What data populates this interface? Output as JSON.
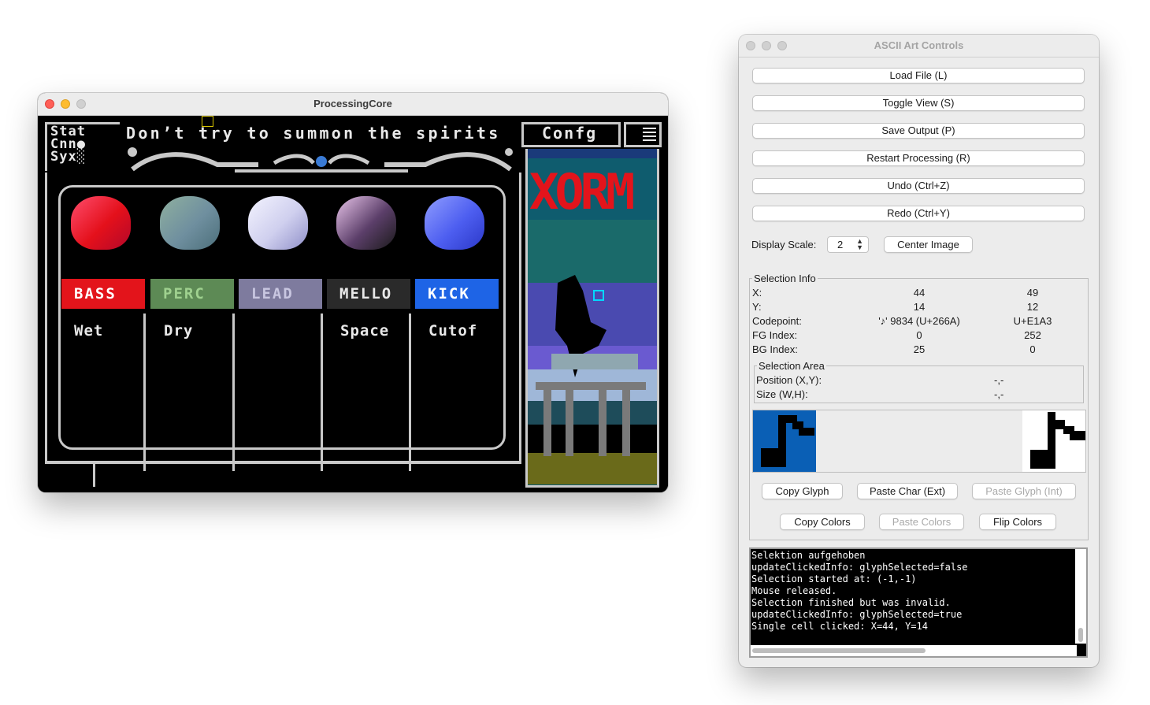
{
  "processing_window": {
    "title": "ProcessingCore",
    "status_lines": [
      "Stat",
      "Cnn●",
      "Syx░"
    ],
    "banner": "Don’t try to summon the spirits",
    "config_label": "Confg",
    "menu_icon": "hamburger-icon",
    "art_title": "XORM",
    "pads": [
      {
        "label": "BASS",
        "color": "#e3141b",
        "label_bg": "#e3141b",
        "label_fg": "#ffffff",
        "blob": [
          "#ff4d6d",
          "#e4101b",
          "#b2082a"
        ]
      },
      {
        "label": "PERC",
        "color": "#6e8f6a",
        "label_bg": "#5d8a55",
        "label_fg": "#9fd18f",
        "blob": [
          "#8fb09f",
          "#6f8f9f",
          "#4c6f7a"
        ]
      },
      {
        "label": "LEAD",
        "color": "#a9a6c6",
        "label_bg": "#7e7b9e",
        "label_fg": "#c8c6e0",
        "blob": [
          "#f4f4ff",
          "#cfcfee",
          "#8f8fc9"
        ]
      },
      {
        "label": "MELLO",
        "color": "#333",
        "label_bg": "#2a2a2a",
        "label_fg": "#e8e8e8",
        "blob": [
          "#e9c5ea",
          "#5c3f6a",
          "#1a1a1a"
        ]
      },
      {
        "label": "KICK",
        "color": "#1e64e6",
        "label_bg": "#1e64e6",
        "label_fg": "#ffffff",
        "blob": [
          "#8f9dff",
          "#4d5ef0",
          "#2b38c8"
        ]
      }
    ],
    "columns": [
      "Wet",
      "Dry",
      "",
      "Space",
      "Cutof"
    ]
  },
  "controls_window": {
    "title": "ASCII Art Controls",
    "buttons": [
      "Load File (L)",
      "Toggle View (S)",
      "Save Output (P)",
      "Restart Processing (R)",
      "Undo (Ctrl+Z)",
      "Redo (Ctrl+Y)"
    ],
    "display_scale_label": "Display Scale:",
    "display_scale_value": "2",
    "center_image_label": "Center Image",
    "selection_info": {
      "title": "Selection Info",
      "rows": [
        {
          "label": "X:",
          "a": "44",
          "b": "49"
        },
        {
          "label": "Y:",
          "a": "14",
          "b": "12"
        },
        {
          "label": "Codepoint:",
          "a": "'♪' 9834 (U+266A)",
          "b": "U+E1A3"
        },
        {
          "label": "FG Index:",
          "a": "0",
          "b": "252"
        },
        {
          "label": "BG Index:",
          "a": "25",
          "b": "0"
        }
      ],
      "area": {
        "title": "Selection Area",
        "position_label": "Position (X,Y):",
        "position_value": "-,-",
        "size_label": "Size (W,H):",
        "size_value": "-,-"
      }
    },
    "glyph_buttons": [
      {
        "label": "Copy Glyph",
        "enabled": true
      },
      {
        "label": "Paste Char (Ext)",
        "enabled": true
      },
      {
        "label": "Paste Glyph (Int)",
        "enabled": false
      }
    ],
    "color_buttons": [
      {
        "label": "Copy Colors",
        "enabled": true
      },
      {
        "label": "Paste Colors",
        "enabled": false
      },
      {
        "label": "Flip Colors",
        "enabled": true
      }
    ],
    "console_lines": [
      "Selektion aufgehoben",
      "updateClickedInfo: glyphSelected=false",
      "Selection started at: (-1,-1)",
      "Mouse released.",
      "Selection finished but was invalid.",
      "updateClickedInfo: glyphSelected=true",
      "Single cell clicked: X=44, Y=14"
    ],
    "preview_colors": {
      "left_bg": "#0a5fb5",
      "right_bg": "#ffffff",
      "glyph": "#000000"
    }
  }
}
